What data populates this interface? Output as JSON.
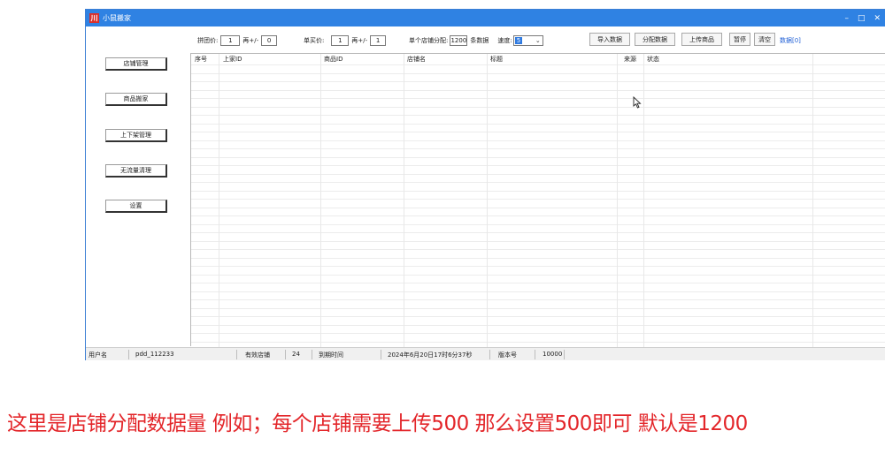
{
  "window": {
    "title": "小鼠搬家",
    "logo_text": "川",
    "minimize": "–",
    "maximize": "□",
    "close": "✕"
  },
  "nav": [
    "店铺管理",
    "商品搬家",
    "上下架管理",
    "无流量清理",
    "设置"
  ],
  "toolbar": {
    "group_price_label": "拼团价:",
    "group_price_value": "1",
    "group_price_op": "再+/-",
    "group_price_adjust": "0",
    "single_price_label": "单买价:",
    "single_price_value": "1",
    "single_price_op": "再+/-",
    "single_price_adjust": "1",
    "per_store_label": "单个店铺分配:",
    "per_store_value": "1200",
    "per_store_unit": "条数据",
    "speed_label": "速度:",
    "speed_value": "5",
    "import_btn": "导入数据",
    "distribute_btn": "分配数据",
    "upload_btn": "上传商品",
    "pause_btn": "暂停",
    "clear_btn": "清空",
    "data_count": "数据[0]"
  },
  "grid": {
    "columns": [
      "序号",
      "上家ID",
      "商品ID",
      "店铺名",
      "标题",
      "来源",
      "状态"
    ]
  },
  "status": {
    "user_label": "用户名",
    "user_value": "pdd_112233",
    "valid_stores_label": "有效店铺",
    "valid_stores_value": "24",
    "expiry_label": "到期时间",
    "expiry_value": "2024年6月20日17时6分37秒",
    "version_label": "版本号",
    "version_value": "10000"
  },
  "caption": "这里是店铺分配数据量  例如；每个店铺需要上传500 那么设置500即可  默认是1200",
  "colors": {
    "titlebar": "#2f82e3",
    "caption": "#e3262a",
    "link": "#1f5fd6"
  }
}
